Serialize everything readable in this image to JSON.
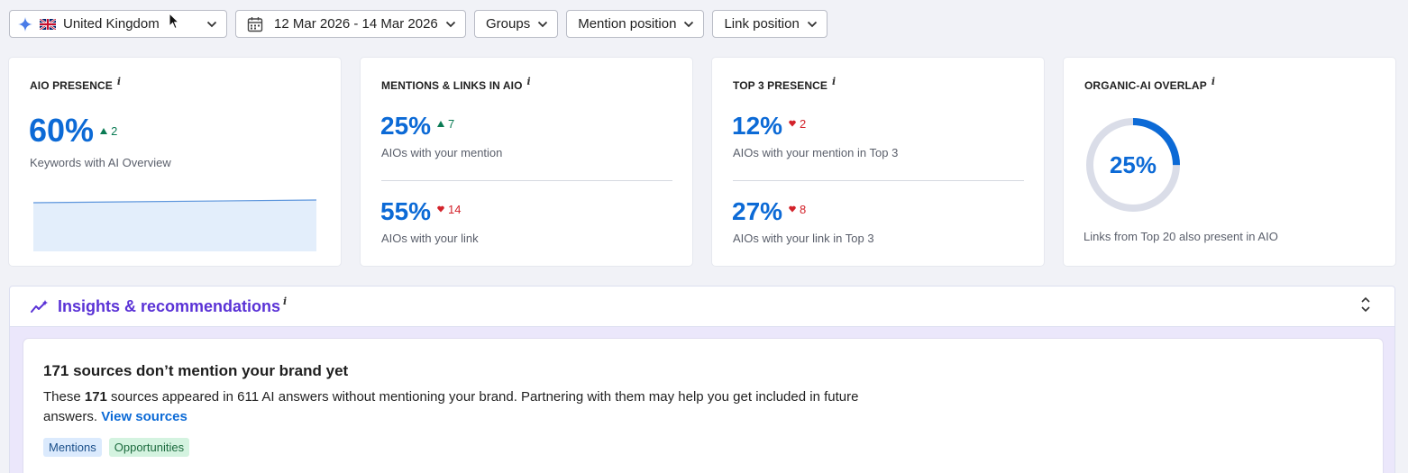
{
  "filters": {
    "region": "United Kingdom",
    "date_range": "12 Mar 2026 - 14 Mar 2026",
    "groups": "Groups",
    "mention_position": "Mention position",
    "link_position": "Link position"
  },
  "cards": {
    "aio_presence": {
      "title": "AIO PRESENCE",
      "value": "60%",
      "delta": "2",
      "delta_direction": "up",
      "subtitle": "Keywords with AI Overview"
    },
    "mentions_links": {
      "title": "MENTIONS & LINKS IN AIO",
      "mention_value": "25%",
      "mention_delta": "7",
      "mention_direction": "up",
      "mention_subtitle": "AIOs with your mention",
      "link_value": "55%",
      "link_delta": "14",
      "link_direction": "down",
      "link_subtitle": "AIOs with your link"
    },
    "top3": {
      "title": "TOP 3 PRESENCE",
      "mention_value": "12%",
      "mention_delta": "2",
      "mention_direction": "down",
      "mention_subtitle": "AIOs with your mention in Top 3",
      "link_value": "27%",
      "link_delta": "8",
      "link_direction": "down",
      "link_subtitle": "AIOs with your link in Top 3"
    },
    "overlap": {
      "title": "ORGANIC-AI OVERLAP",
      "value": "25%",
      "fraction": 0.25,
      "subtitle": "Links from Top 20 also present in AIO"
    }
  },
  "insights": {
    "title": "Insights & recommendations",
    "recommendation": {
      "title": "171 sources don’t mention your brand yet",
      "text_prefix": "These ",
      "text_bold": "171",
      "text_suffix": " sources appeared in 611 AI answers without mentioning your brand. Partnering with them may help you get included in future answers. ",
      "link_label": "View sources",
      "tags": [
        "Mentions",
        "Opportunities"
      ]
    }
  },
  "colors": {
    "accent_blue": "#0c6ad6",
    "insights_purple": "#5a32d6",
    "up_green": "#0a7b54",
    "down_red": "#d3222a"
  }
}
